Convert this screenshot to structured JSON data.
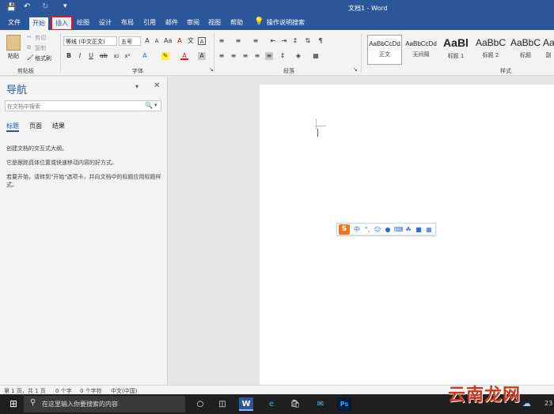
{
  "window": {
    "title": "文档1 - Word"
  },
  "tabs": [
    "文件",
    "开始",
    "插入",
    "绘图",
    "设计",
    "布局",
    "引用",
    "邮件",
    "审阅",
    "视图",
    "帮助"
  ],
  "tell_me": "操作说明搜索",
  "ribbon": {
    "clipboard": {
      "paste": "粘贴",
      "cut": "剪切",
      "copy": "复制",
      "format_painter": "格式刷",
      "label": "剪贴板"
    },
    "font": {
      "font_name": "等线 (中文正文)",
      "font_size": "五号",
      "label": "字体"
    },
    "paragraph": {
      "label": "段落"
    },
    "styles": {
      "label": "样式",
      "items": [
        {
          "sample": "AaBbCcDd",
          "name": "正文"
        },
        {
          "sample": "AaBbCcDd",
          "name": "无间隔"
        },
        {
          "sample": "AaBl",
          "name": "标题 1"
        },
        {
          "sample": "AaBbC",
          "name": "标题 2"
        },
        {
          "sample": "AaBbC",
          "name": "标题"
        },
        {
          "sample": "Aa",
          "name": "副"
        }
      ]
    }
  },
  "nav": {
    "title": "导航",
    "search_placeholder": "在文档中搜索",
    "tabs": [
      "标题",
      "页面",
      "结果"
    ],
    "text1": "创建文档的交互式大纲。",
    "text2": "它是跟踪具体位置或快速移动内容的好方式。",
    "text3": "若要开始，请转到\"开始\"选项卡，并向文档中的标题应用标题样式。"
  },
  "status": {
    "page": "第 1 页，共 1 页",
    "words": "0 个字",
    "chars": "0 个字符",
    "lang": "中文(中国)"
  },
  "taskbar": {
    "search_placeholder": "在这里输入你要搜索的内容",
    "clock": "23"
  },
  "watermark": "云南龙网",
  "colors": {
    "accent": "#2b579a",
    "highlight_box": "#e81123",
    "taskbar": "#1f1f1f",
    "ime_s": "#f07818"
  }
}
